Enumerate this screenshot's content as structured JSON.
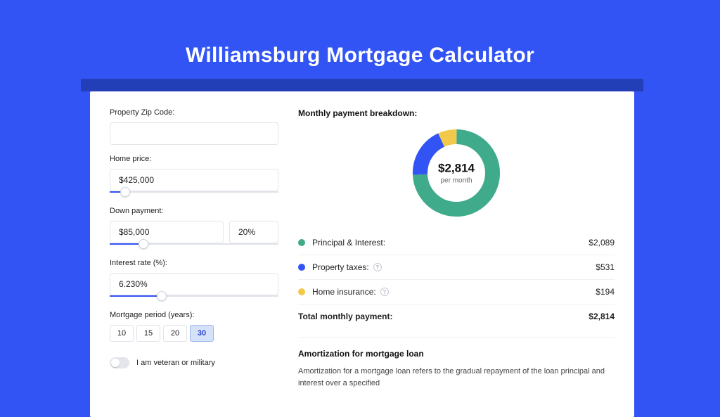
{
  "page_title": "Williamsburg Mortgage Calculator",
  "form": {
    "zip_label": "Property Zip Code:",
    "zip_value": "",
    "home_price_label": "Home price:",
    "home_price_value": "$425,000",
    "home_price_slider_pct": 9,
    "down_payment_label": "Down payment:",
    "down_payment_value": "$85,000",
    "down_payment_pct_value": "20%",
    "down_payment_slider_pct": 20,
    "interest_label": "Interest rate (%):",
    "interest_value": "6.230%",
    "interest_slider_pct": 31,
    "period_label": "Mortgage period (years):",
    "period_options": [
      "10",
      "15",
      "20",
      "30"
    ],
    "period_selected": "30",
    "veteran_label": "I am veteran or military"
  },
  "breakdown": {
    "title": "Monthly payment breakdown:",
    "center_value": "$2,814",
    "center_sub": "per month",
    "items": [
      {
        "label": "Principal & Interest:",
        "value": "$2,089",
        "color": "#3fab8a",
        "has_info": false,
        "amount": 2089
      },
      {
        "label": "Property taxes:",
        "value": "$531",
        "color": "#3254f4",
        "has_info": true,
        "amount": 531
      },
      {
        "label": "Home insurance:",
        "value": "$194",
        "color": "#f3c94b",
        "has_info": true,
        "amount": 194
      }
    ],
    "total_label": "Total monthly payment:",
    "total_value": "$2,814"
  },
  "amortization": {
    "title": "Amortization for mortgage loan",
    "text": "Amortization for a mortgage loan refers to the gradual repayment of the loan principal and interest over a specified"
  },
  "chart_data": {
    "type": "pie",
    "title": "Monthly payment breakdown",
    "series": [
      {
        "name": "Principal & Interest",
        "value": 2089,
        "color": "#3fab8a"
      },
      {
        "name": "Property taxes",
        "value": 531,
        "color": "#3254f4"
      },
      {
        "name": "Home insurance",
        "value": 194,
        "color": "#f3c94b"
      }
    ],
    "total": 2814,
    "center_label": "$2,814 per month"
  }
}
